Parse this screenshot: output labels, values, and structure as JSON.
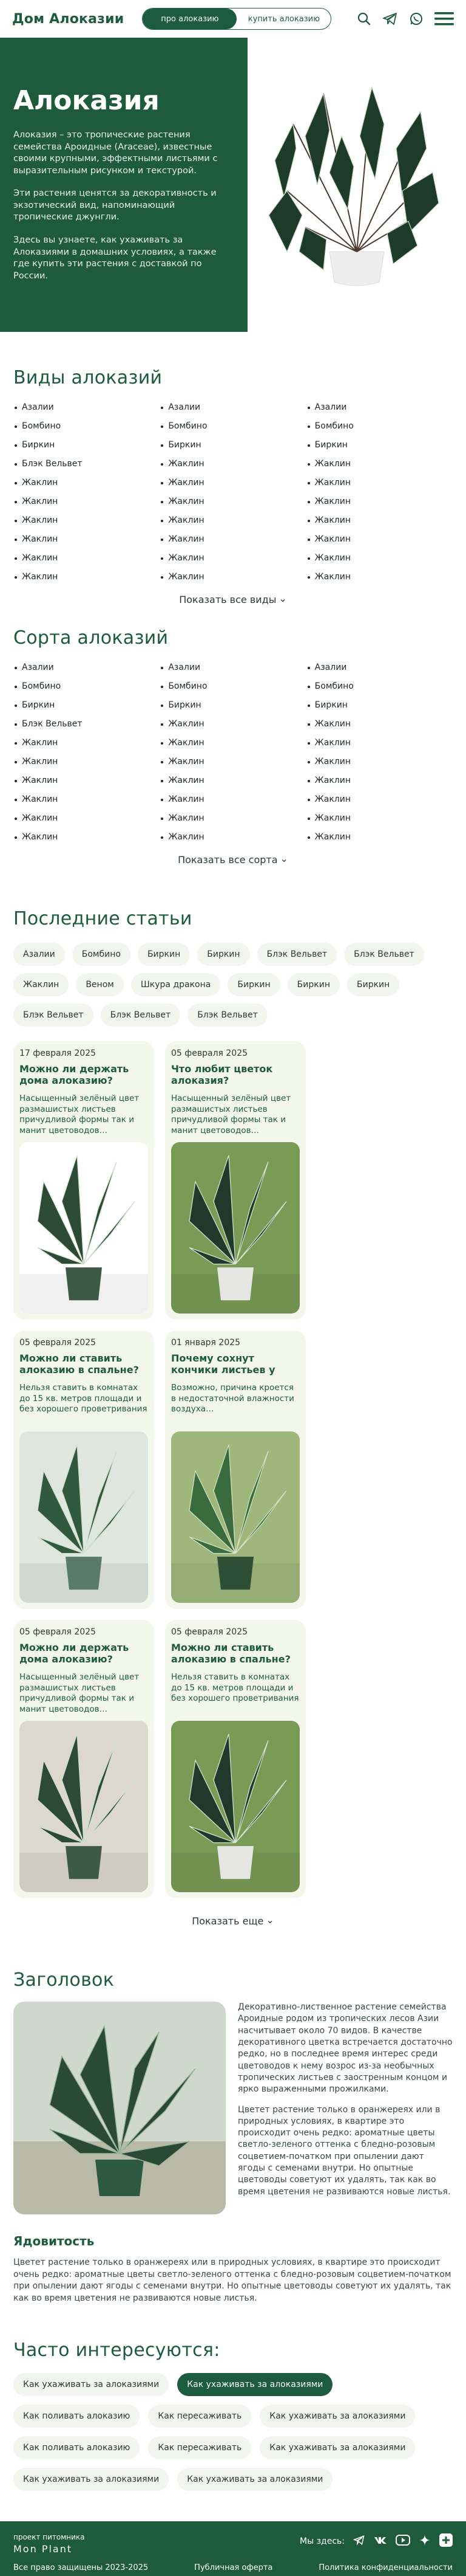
{
  "header": {
    "logo": "Дом Алоказии",
    "switch": {
      "active": "про алоказию",
      "inactive": "купить алоказию"
    },
    "icons": [
      "search-icon",
      "telegram-icon",
      "whatsapp-icon",
      "menu-icon"
    ]
  },
  "hero": {
    "title": "Алоказия",
    "p1": "Алоказия – это тропические растения семейства Ароидные (Araceae), известные своими крупными, эффектными листьями с выразительным рисунком и текстурой.",
    "p2": "Эти растения ценятся за декоративность и экзотический вид, напоминающий тропические джунгли.",
    "p3": "Здесь вы узнаете, как ухаживать за Алоказиями в домашних условиях, а также где купить эти растения с доставкой по России."
  },
  "species": {
    "title": "Виды алоказий",
    "columns": [
      [
        "Азалии",
        "Бомбино",
        "Биркин",
        "Блэк Вельвет",
        "Жаклин",
        "Жаклин",
        "Жаклин",
        "Жаклин",
        "Жаклин",
        "Жаклин"
      ],
      [
        "Азалии",
        "Бомбино",
        "Биркин",
        "Жаклин",
        "Жаклин",
        "Жаклин",
        "Жаклин",
        "Жаклин",
        "Жаклин",
        "Жаклин"
      ],
      [
        "Азалии",
        "Бомбино",
        "Биркин",
        "Жаклин",
        "Жаклин",
        "Жаклин",
        "Жаклин",
        "Жаклин",
        "Жаклин",
        "Жаклин"
      ]
    ],
    "more": "Показать все виды"
  },
  "varieties": {
    "title": "Сорта алоказий",
    "columns": [
      [
        "Азалии",
        "Бомбино",
        "Биркин",
        "Блэк Вельвет",
        "Жаклин",
        "Жаклин",
        "Жаклин",
        "Жаклин",
        "Жаклин",
        "Жаклин"
      ],
      [
        "Азалии",
        "Бомбино",
        "Биркин",
        "Жаклин",
        "Жаклин",
        "Жаклин",
        "Жаклин",
        "Жаклин",
        "Жаклин",
        "Жаклин"
      ],
      [
        "Азалии",
        "Бомбино",
        "Биркин",
        "Жаклин",
        "Жаклин",
        "Жаклин",
        "Жаклин",
        "Жаклин",
        "Жаклин",
        "Жаклин"
      ]
    ],
    "more": "Показать все сорта"
  },
  "articles": {
    "title": "Последние статьи",
    "tags": [
      "Азалии",
      "Бомбино",
      "Биркин",
      "Биркин",
      "Блэк Вельвет",
      "Блэк Вельвет",
      "Жаклин",
      "Веном",
      "Шкура дракона",
      "Биркин",
      "Биркин",
      "Биркин",
      "Блэк Вельвет",
      "Блэк Вельвет",
      "Блэк Вельвет"
    ],
    "cards": [
      {
        "date": "17 февраля 2025",
        "title": "Можно ли держать дома алоказию?",
        "text": "Насыщенный зелёный цвет размашистых листьев причудливой формы так и манит цветоводов…"
      },
      {
        "date": "05 февраля 2025",
        "title": "Что любит цветок алоказия?",
        "text": "Насыщенный зелёный цвет размашистых листьев причудливой формы так и манит цветоводов…"
      },
      {
        "date": "05 февраля 2025",
        "title": "Можно ли ставить алоказию в спальне?",
        "text": "Нельзя ставить в комнатах до 15 кв. метров площади и без хорошего проветривания"
      },
      {
        "date": "01 января 2025",
        "title": "Почему сохнут кончики листьев у алоказии?",
        "text": "Возможно, причина кроется в недостаточной влажности воздуха…"
      },
      {
        "date": "05 февраля 2025",
        "title": "Можно ли держать дома алоказию?",
        "text": "Насыщенный зелёный цвет размашистых листьев причудливой формы так и манит цветоводов…"
      },
      {
        "date": "05 февраля 2025",
        "title": "Можно ли ставить алоказию в спальне?",
        "text": "Нельзя ставить в комнатах до 15 кв. метров площади и без хорошего проветривания"
      }
    ],
    "more": "Показать еще"
  },
  "article": {
    "title": "Заголовок",
    "p1": "Декоративно-лиственное растение семейства Ароидные родом из тропических лесов Азии насчитывает около 70 видов. В качестве декоративного цветка встречается достаточно редко, но в последнее время интерес среди цветоводов к нему возрос из-за необычных тропических листьев с заостренным концом и ярко выраженными прожилками.",
    "p2": "Цветет растение только в оранжереях или в природных условиях, в квартире это происходит очень редко: ароматные цветы светло-зеленого оттенка с бледно-розовым соцветием-початком при опылении дают ягоды с семенами внутри. Но опытные цветоводы советуют их удалять, так как во время цветения не развиваются новые листья.",
    "toxicity_title": "Ядовитость",
    "toxicity_text": "Цветет растение только в оранжереях или в природных условиях, в квартире это происходит очень редко: ароматные цветы светло-зеленого оттенка с бледно-розовым соцветием-початком при опылении дают ягоды с семенами внутри. Но опытные цветоводы советуют их удалять, так как во время цветения не развиваются новые листья."
  },
  "faq": {
    "title": "Часто интересуются:",
    "chips": [
      {
        "label": "Как ухаживать за алоказиями",
        "active": false
      },
      {
        "label": "Как ухаживать за алоказиями",
        "active": true
      },
      {
        "label": "Как поливать алоказию",
        "active": false
      },
      {
        "label": "Как пересаживать",
        "active": false
      },
      {
        "label": "Как ухаживать за алоказиями",
        "active": false
      },
      {
        "label": "Как поливать алоказию",
        "active": false
      },
      {
        "label": "Как пересаживать",
        "active": false
      },
      {
        "label": "Как ухаживать за алоказиями",
        "active": false
      },
      {
        "label": "Как ухаживать за алоказиями",
        "active": false
      },
      {
        "label": "Как ухаживать за алоказиями",
        "active": false
      }
    ]
  },
  "footer": {
    "project": "проект питомника",
    "brand": "Mon Plant",
    "social_label": "Мы здесь:",
    "copyright": "Все право защищены 2023-2025",
    "offer": "Публичная оферта",
    "privacy": "Политика конфиденциальности",
    "social_icons": [
      "telegram-icon",
      "vk-icon",
      "youtube-icon",
      "dzen-icon",
      "plus-icon"
    ]
  },
  "colors": {
    "brand_green": "#1e5a3c",
    "card_bg": "#f4f8ec",
    "chip_bg": "#f3f5f1"
  }
}
